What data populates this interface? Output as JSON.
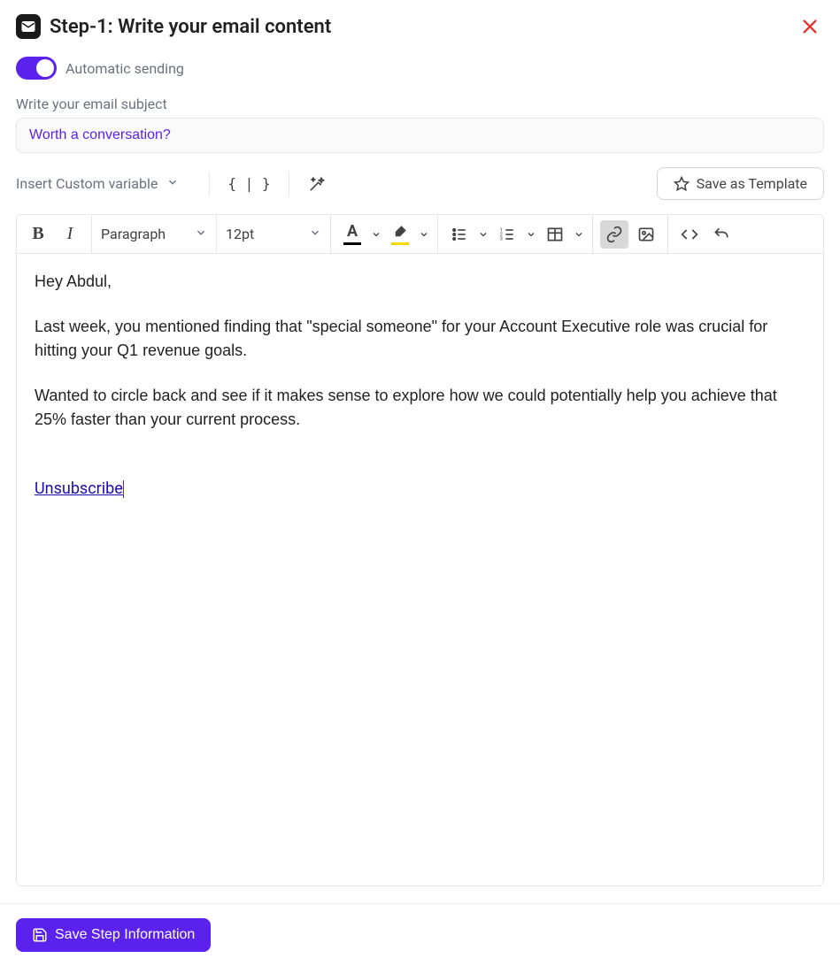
{
  "header": {
    "title": "Step-1:  Write your email content"
  },
  "toggle": {
    "label": "Automatic sending",
    "on": true
  },
  "subject": {
    "label": "Write your email subject",
    "value": "Worth a conversation?"
  },
  "secondary": {
    "custom_var_label": "Insert Custom variable",
    "save_template_label": "Save as Template"
  },
  "toolbar": {
    "paragraph_label": "Paragraph",
    "fontsize_label": "12pt"
  },
  "body": {
    "greeting": "Hey Abdul,",
    "para1": "Last week, you mentioned finding that \"special someone\" for your Account Executive role was crucial for hitting your Q1 revenue goals.",
    "para2": "Wanted to circle back and see if it makes sense to explore how we could potentially help you achieve that 25% faster than your current process.",
    "unsubscribe": "Unsubscribe"
  },
  "footer": {
    "save_step_label": "Save Step Information"
  }
}
